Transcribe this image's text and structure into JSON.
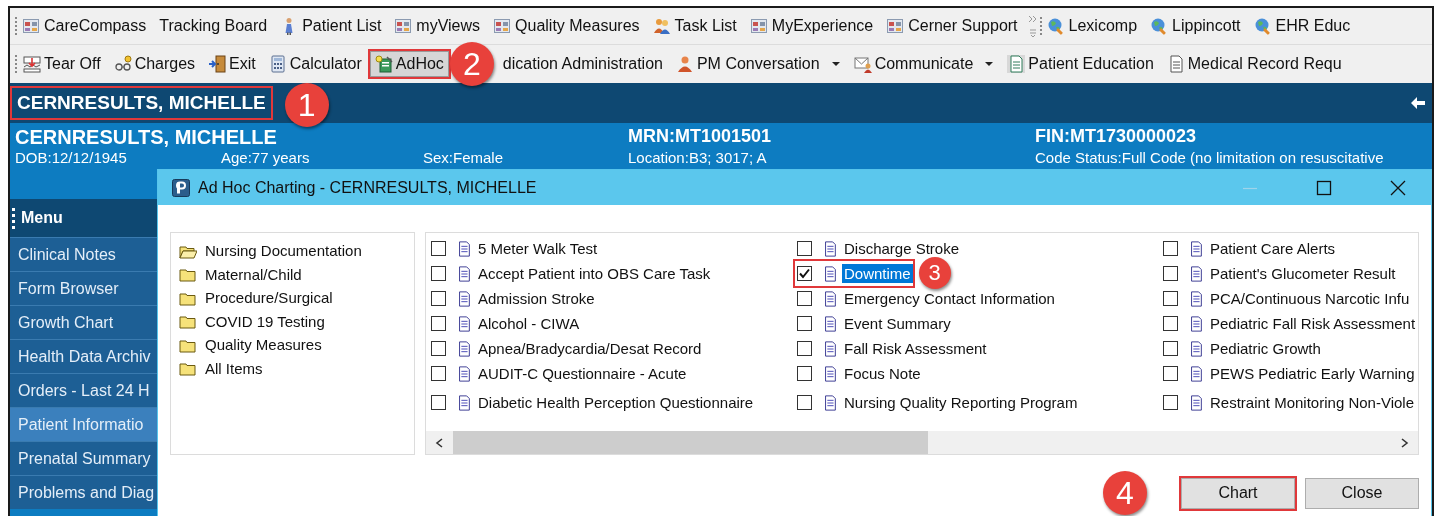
{
  "toolbar_top": {
    "groups": [
      {
        "overflow": true,
        "items": [
          {
            "label": "CareCompass"
          },
          {
            "label": "Tracking Board"
          },
          {
            "label": "Patient List"
          },
          {
            "label": "myViews"
          },
          {
            "label": "Quality Measures"
          },
          {
            "label": "Task List"
          },
          {
            "label": "MyExperience"
          },
          {
            "label": "Cerner Support"
          }
        ]
      },
      {
        "overflow": false,
        "items": [
          {
            "label": "Lexicomp"
          },
          {
            "label": "Lippincott"
          },
          {
            "label": "EHR Educ"
          }
        ]
      }
    ]
  },
  "toolbar_bottom": {
    "items": [
      {
        "label": "Tear Off",
        "pressed": false,
        "dropdown": false,
        "highlighted": false
      },
      {
        "label": "Charges",
        "pressed": false,
        "dropdown": false,
        "highlighted": false
      },
      {
        "label": "Exit",
        "pressed": false,
        "dropdown": false,
        "highlighted": false
      },
      {
        "label": "Calculator",
        "pressed": false,
        "dropdown": false,
        "highlighted": false
      },
      {
        "label": "AdHoc",
        "pressed": true,
        "dropdown": false,
        "highlighted": true,
        "callout": "2"
      },
      {
        "label": "dication Administration",
        "pressed": false,
        "dropdown": false,
        "highlighted": false
      },
      {
        "label": "PM Conversation",
        "pressed": false,
        "dropdown": true,
        "highlighted": false
      },
      {
        "label": "Communicate",
        "pressed": false,
        "dropdown": true,
        "highlighted": false
      },
      {
        "label": "Patient Education",
        "pressed": false,
        "dropdown": false,
        "highlighted": false
      },
      {
        "label": "Medical Record Requ",
        "pressed": false,
        "dropdown": false,
        "highlighted": false
      }
    ]
  },
  "banner": {
    "name": "CERNRESULTS, MICHELLE",
    "highlighted": true,
    "callout": "1"
  },
  "header": {
    "name": "CERNRESULTS, MICHELLE",
    "mrn": "MRN:MT1001501",
    "fin": "FIN:MT1730000023",
    "dob": "DOB:12/12/1945",
    "age": "Age:77 years",
    "sex": "Sex:Female",
    "location": "Location:B3; 3017; A",
    "code_status": "Code Status:Full Code (no limitation on resuscitative"
  },
  "sidebar": {
    "title": "Menu",
    "items": [
      {
        "label": "Clinical Notes",
        "selected": false
      },
      {
        "label": "Form Browser",
        "selected": false
      },
      {
        "label": "Growth Chart",
        "selected": false
      },
      {
        "label": "Health Data Archiv",
        "selected": false
      },
      {
        "label": "Orders - Last 24 H",
        "selected": false
      },
      {
        "label": "Patient Informatio",
        "selected": true
      },
      {
        "label": "Prenatal Summary",
        "selected": false
      },
      {
        "label": "Problems and Diag",
        "selected": false
      }
    ]
  },
  "dialog": {
    "title": "Ad Hoc Charting - CERNRESULTS, MICHELLE",
    "minimize_enabled": false,
    "folders": [
      {
        "label": "Nursing Documentation",
        "open": true
      },
      {
        "label": "Maternal/Child",
        "open": false
      },
      {
        "label": "Procedure/Surgical",
        "open": false
      },
      {
        "label": "COVID 19 Testing",
        "open": false
      },
      {
        "label": "Quality Measures",
        "open": false
      },
      {
        "label": "All Items",
        "open": false
      }
    ],
    "columns": [
      {
        "items": [
          {
            "label": "5 Meter Walk Test",
            "checked": false,
            "selected": false,
            "highlighted": false
          },
          {
            "label": "Accept Patient into OBS Care Task",
            "checked": false,
            "selected": false,
            "highlighted": false
          },
          {
            "label": "Admission Stroke",
            "checked": false,
            "selected": false,
            "highlighted": false
          },
          {
            "label": "Alcohol - CIWA",
            "checked": false,
            "selected": false,
            "highlighted": false
          },
          {
            "label": "Apnea/Bradycardia/Desat Record",
            "checked": false,
            "selected": false,
            "highlighted": false
          },
          {
            "label": "AUDIT-C Questionnaire - Acute",
            "checked": false,
            "selected": false,
            "highlighted": false
          },
          {
            "label": "Diabetic Health Perception Questionnaire",
            "checked": false,
            "selected": false,
            "highlighted": false
          }
        ]
      },
      {
        "items": [
          {
            "label": "Discharge Stroke",
            "checked": false,
            "selected": false,
            "highlighted": false
          },
          {
            "label": "Downtime",
            "checked": true,
            "selected": true,
            "highlighted": true,
            "callout": "3"
          },
          {
            "label": "Emergency Contact Information",
            "checked": false,
            "selected": false,
            "highlighted": false
          },
          {
            "label": "Event Summary",
            "checked": false,
            "selected": false,
            "highlighted": false
          },
          {
            "label": "Fall Risk Assessment",
            "checked": false,
            "selected": false,
            "highlighted": false
          },
          {
            "label": "Focus Note",
            "checked": false,
            "selected": false,
            "highlighted": false
          },
          {
            "label": "Nursing Quality Reporting Program",
            "checked": false,
            "selected": false,
            "highlighted": false
          }
        ]
      },
      {
        "items": [
          {
            "label": "Patient Care Alerts",
            "checked": false,
            "selected": false,
            "highlighted": false
          },
          {
            "label": "Patient's Glucometer Result",
            "checked": false,
            "selected": false,
            "highlighted": false
          },
          {
            "label": "PCA/Continuous Narcotic Infu",
            "checked": false,
            "selected": false,
            "highlighted": false
          },
          {
            "label": "Pediatric Fall Risk Assessment",
            "checked": false,
            "selected": false,
            "highlighted": false
          },
          {
            "label": "Pediatric Growth",
            "checked": false,
            "selected": false,
            "highlighted": false
          },
          {
            "label": "PEWS Pediatric Early Warning",
            "checked": false,
            "selected": false,
            "highlighted": false
          },
          {
            "label": "Restraint Monitoring Non-Viole",
            "checked": false,
            "selected": false,
            "highlighted": false
          }
        ]
      }
    ],
    "buttons": [
      {
        "label": "Chart",
        "highlighted": true,
        "callout": "4"
      },
      {
        "label": "Close",
        "highlighted": false
      }
    ]
  }
}
